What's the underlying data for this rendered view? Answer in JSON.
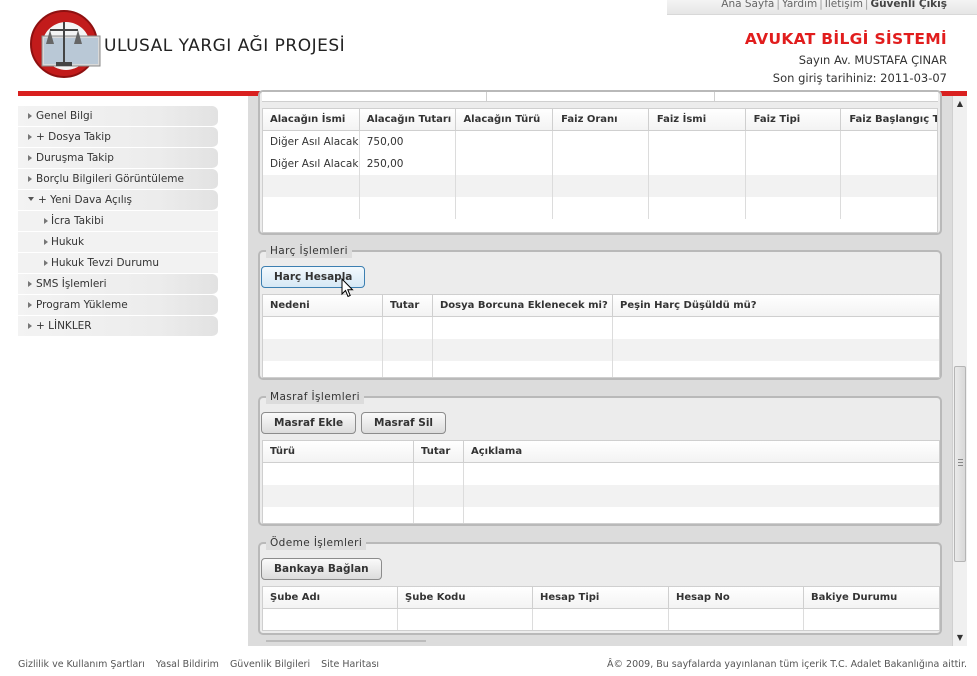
{
  "header": {
    "top_links": [
      "Ana Sayfa",
      "Yardım",
      "İletişim",
      "Güvenli Çıkış"
    ],
    "project_title": "ULUSAL YARGI AĞI PROJESİ",
    "system_title": "AVUKAT BİLGİ SİSTEMİ",
    "user_name": "Sayın Av. MUSTAFA ÇINAR",
    "last_login": "Son giriş tarihiniz: 2011-03-07",
    "accent_color": "#d9201f"
  },
  "sidebar": {
    "items": [
      {
        "label": "Genel Bilgi"
      },
      {
        "label": "+ Dosya Takip"
      },
      {
        "label": "Duruşma Takip"
      },
      {
        "label": "Borçlu Bilgileri Görüntüleme"
      },
      {
        "label": "+ Yeni Dava Açılış",
        "expanded": true
      },
      {
        "label": "İcra Takibi"
      },
      {
        "label": "Hukuk"
      },
      {
        "label": "Hukuk Tevzi Durumu Sorgulama"
      },
      {
        "label": "SMS İşlemleri"
      },
      {
        "label": "Program Yükleme"
      },
      {
        "label": "+ LİNKLER"
      }
    ]
  },
  "alacak": {
    "columns": [
      "Alacağın İsmi",
      "Alacağın Tutarı",
      "Alacağın Türü",
      "Faiz Oranı",
      "Faiz İsmi",
      "Faiz Tipi",
      "Faiz Başlangıç T"
    ],
    "rows": [
      [
        "Diğer Asıl Alacak",
        "750,00",
        "",
        "",
        "",
        "",
        ""
      ],
      [
        "Diğer Asıl Alacak",
        "250,00",
        "",
        "",
        "",
        "",
        ""
      ]
    ]
  },
  "harc": {
    "legend": "Harç İşlemleri",
    "button": "Harç Hesapla",
    "columns": [
      "Nedeni",
      "Tutar",
      "Dosya Borcuna Eklenecek mi?",
      "Peşin Harç Düşüldü mü?"
    ]
  },
  "masraf": {
    "legend": "Masraf İşlemleri",
    "add_button": "Masraf Ekle",
    "delete_button": "Masraf Sil",
    "columns": [
      "Türü",
      "Tutar",
      "Açıklama"
    ]
  },
  "odeme": {
    "legend": "Ödeme İşlemleri",
    "button": "Bankaya Bağlan",
    "columns": [
      "Şube Adı",
      "Şube Kodu",
      "Hesap Tipi",
      "Hesap No",
      "Bakiye Durumu"
    ]
  },
  "footer": {
    "links": [
      "Gizlilik ve Kullanım Şartları",
      "Yasal Bildirim",
      "Güvenlik Bilgileri",
      "Site Haritası"
    ],
    "copyright": "Â© 2009, Bu sayfalarda yayınlanan tüm içerik T.C. Adalet Bakanlığına aittir."
  }
}
